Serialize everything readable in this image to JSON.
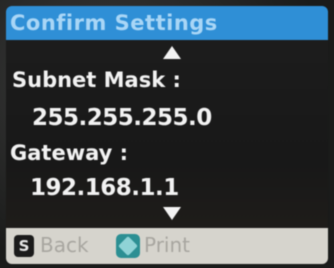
{
  "header": {
    "title": "Confirm Settings"
  },
  "settings": [
    {
      "label": "Subnet Mask :",
      "value": "255.255.255.0"
    },
    {
      "label": "Gateway :",
      "value": "192.168.1.1"
    }
  ],
  "footer": {
    "back_key": "S",
    "back_label": "Back",
    "print_label": "Print"
  },
  "icons": {
    "scroll_up": "triangle-up-icon",
    "scroll_down": "triangle-down-icon",
    "back": "back-key-icon",
    "print": "start-diamond-icon"
  },
  "colors": {
    "title_bar": "#2f8fd6",
    "title_text": "#a9d6f6",
    "text": "#f2f2f2",
    "screen_bg": "#1e1e1e",
    "bottom_bar": "#d6d4cd",
    "print_icon": "#2c8f93"
  }
}
